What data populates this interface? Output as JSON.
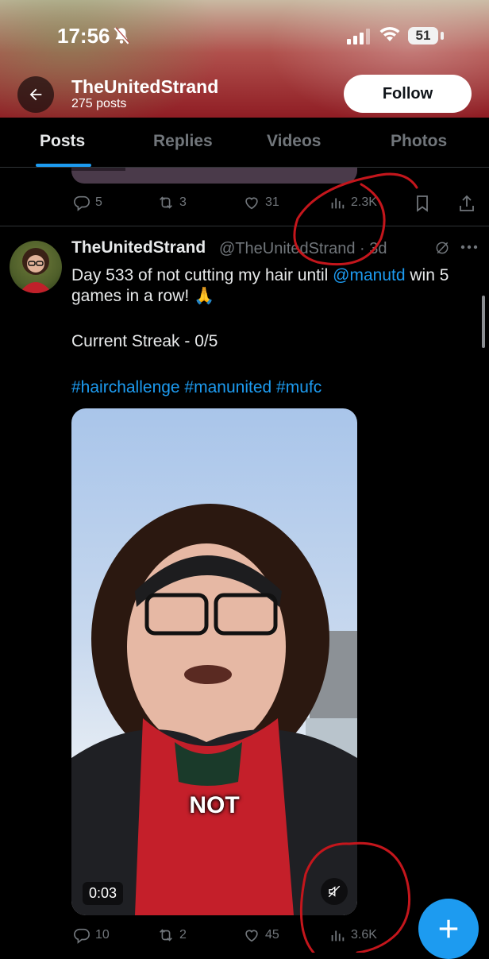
{
  "status_bar": {
    "time": "17:56",
    "battery": "51"
  },
  "profile": {
    "name": "TheUnitedStrand",
    "posts": "275 posts",
    "follow_label": "Follow"
  },
  "tabs": [
    {
      "label": "Posts",
      "active": true
    },
    {
      "label": "Replies",
      "active": false
    },
    {
      "label": "Videos",
      "active": false
    },
    {
      "label": "Photos",
      "active": false
    }
  ],
  "tweet1": {
    "replies": "5",
    "retweets": "3",
    "likes": "31",
    "views": "2.3K"
  },
  "tweet2": {
    "author": "TheUnitedStrand",
    "handle": "@TheUnitedStrand · 3d",
    "text_before_mention": "Day 533 of not cutting my hair until ",
    "mention": "@manutd",
    "text_after_mention": " win 5",
    "text_line2": "games in a row! 🙏",
    "streak": "Current Streak - 0/5",
    "hashtags": "#hairchallenge #manunited #mufc",
    "video_caption": "NOT",
    "video_time": "0:03",
    "replies": "10",
    "retweets": "2",
    "likes": "45",
    "views": "3.6K"
  },
  "colors": {
    "accent": "#1d9bf0",
    "annotation_red": "#c4161c"
  }
}
